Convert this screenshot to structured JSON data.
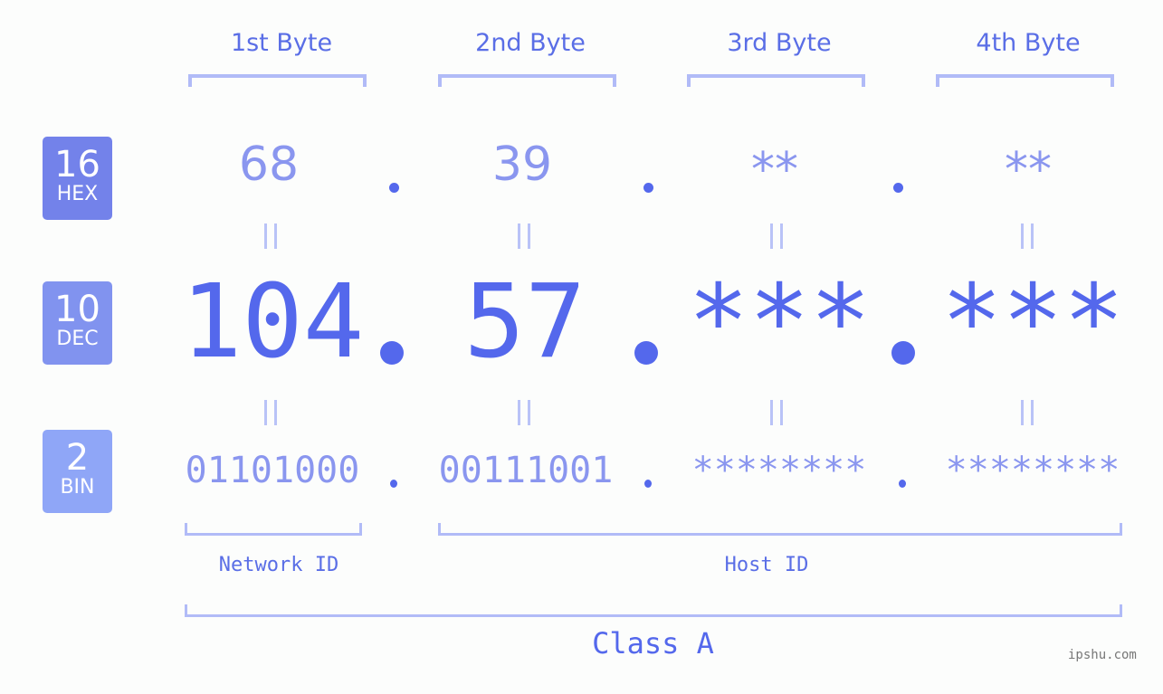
{
  "notations": [
    {
      "number": "16",
      "label": "HEX",
      "color": "#7382ea"
    },
    {
      "number": "10",
      "label": "DEC",
      "color": "#8193ef"
    },
    {
      "number": "2",
      "label": "BIN",
      "color": "#8fa6f7"
    }
  ],
  "bytes": [
    {
      "title": "1st Byte",
      "hex": "68",
      "dec": "104",
      "bin": "01101000"
    },
    {
      "title": "2nd Byte",
      "hex": "39",
      "dec": "57",
      "bin": "00111001"
    },
    {
      "title": "3rd Byte",
      "hex": "**",
      "dec": "***",
      "bin": "********"
    },
    {
      "title": "4th Byte",
      "hex": "**",
      "dec": "***",
      "bin": "********"
    }
  ],
  "segments": {
    "network_id": "Network ID",
    "host_id": "Host ID"
  },
  "ip_class": "Class A",
  "watermark": "ipshu.com",
  "colors": {
    "accent": "#5468ec",
    "light": "#8a96ef",
    "bracket": "#b1bbf7"
  }
}
